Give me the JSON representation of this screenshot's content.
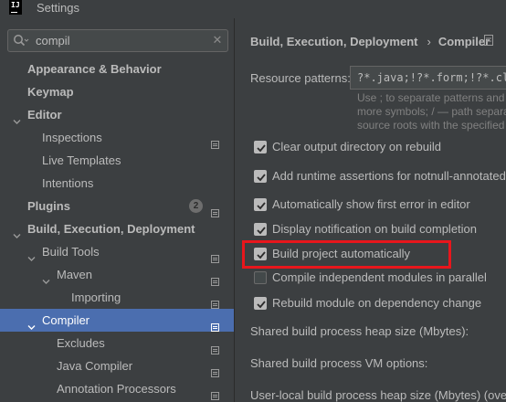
{
  "window": {
    "title": "Settings",
    "logo_text": "IJ"
  },
  "search": {
    "value": "compil",
    "placeholder": ""
  },
  "tree": [
    {
      "label": "Appearance & Behavior",
      "bold": true,
      "indent": 30,
      "chevron": "none"
    },
    {
      "label": "Keymap",
      "bold": true,
      "indent": 30,
      "chevron": "none"
    },
    {
      "label": "Editor",
      "bold": true,
      "indent": 30,
      "chevron": "down"
    },
    {
      "label": "Inspections",
      "bold": false,
      "indent": 46,
      "chevron": "none",
      "proj": true
    },
    {
      "label": "Live Templates",
      "bold": false,
      "indent": 46,
      "chevron": "none"
    },
    {
      "label": "Intentions",
      "bold": false,
      "indent": 46,
      "chevron": "none"
    },
    {
      "label": "Plugins",
      "bold": true,
      "indent": 30,
      "chevron": "none",
      "badge": "2",
      "proj": true
    },
    {
      "label": "Build, Execution, Deployment",
      "bold": true,
      "indent": 30,
      "chevron": "down"
    },
    {
      "label": "Build Tools",
      "bold": false,
      "indent": 46,
      "chevron": "down",
      "proj": true
    },
    {
      "label": "Maven",
      "bold": false,
      "indent": 62,
      "chevron": "down",
      "proj": true
    },
    {
      "label": "Importing",
      "bold": false,
      "indent": 78,
      "chevron": "none",
      "proj": true
    },
    {
      "label": "Compiler",
      "bold": false,
      "indent": 46,
      "chevron": "down",
      "proj": true,
      "selected": true
    },
    {
      "label": "Excludes",
      "bold": false,
      "indent": 62,
      "chevron": "none",
      "proj": true
    },
    {
      "label": "Java Compiler",
      "bold": false,
      "indent": 62,
      "chevron": "none",
      "proj": true
    },
    {
      "label": "Annotation Processors",
      "bold": false,
      "indent": 62,
      "chevron": "none",
      "proj": true
    }
  ],
  "breadcrumb": {
    "parent": "Build, Execution, Deployment",
    "separator": "›",
    "current": "Compiler"
  },
  "resource_patterns": {
    "label": "Resource patterns:",
    "value": "?*.java;!?*.form;!?*.cla",
    "hint_lines": [
      "Use ; to separate patterns and",
      "more symbols; / — path separa",
      "source roots with the specified"
    ]
  },
  "checkboxes": [
    {
      "label": "Clear output directory on rebuild",
      "checked": true
    },
    {
      "label": "Add runtime assertions for notnull-annotated m",
      "checked": true
    },
    {
      "label": "Automatically show first error in editor",
      "checked": true
    },
    {
      "label": "Display notification on build completion",
      "checked": true
    },
    {
      "label": "Build project automatically",
      "checked": true
    },
    {
      "label": "Compile independent modules in parallel",
      "checked": false
    },
    {
      "label": "Rebuild module on dependency change",
      "checked": true
    }
  ],
  "fields": [
    {
      "label": "Shared build process heap size (Mbytes):"
    },
    {
      "label": "Shared build process VM options:"
    },
    {
      "label": "User-local build process heap size (Mbytes) (overrid"
    }
  ],
  "colors": {
    "selection": "#4b6eaf",
    "highlight_box": "#e8161c",
    "background": "#3c3f41"
  }
}
